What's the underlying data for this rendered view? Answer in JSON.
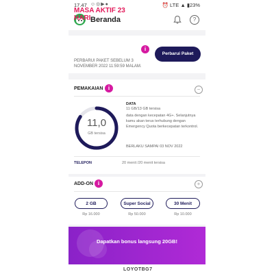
{
  "status_bar": {
    "time": "17.47",
    "network": "LTE",
    "battery": "23%"
  },
  "app_bar": {
    "title": "Beranda",
    "icons": [
      "logo-icon",
      "bell-icon",
      "help-icon"
    ]
  },
  "package": {
    "title": "MASA AKTIF 23 HARI",
    "info_icon": "i",
    "renew_button": "Perbarui Paket",
    "renew_note": "PERBARUI PAKET SEBELUM 3 NOVEMBER 2022 11:59:59 MALAM."
  },
  "usage": {
    "section_title": "PEMAKAIAN",
    "ring_value": "11,0",
    "ring_unit": "GB tersisa",
    "remaining_fraction": 0.846,
    "data_title": "DATA",
    "data_used": "11 GB/13 GB tersisa",
    "data_desc": "data dengan kecepatan 4G+. Selanjutnya kamu akan terus terhubung dengan Emergency Quota berkecepatan terkontrol.",
    "data_valid": "BERLAKU SAMPAI 03 NOV 2022",
    "phone_label": "TELEPON",
    "phone_value": "20 menit /20 menit  tersisa"
  },
  "addons": {
    "section_title": "ADD-ON",
    "items": [
      {
        "label": "2 GB",
        "price": "Rp 16.000"
      },
      {
        "label": "Super Social",
        "price": "Rp 50.000"
      },
      {
        "label": "30 Menit",
        "price": "Rp 10.000"
      }
    ]
  },
  "banner": {
    "text": "Dapatkan bonus langsung 20GB!"
  },
  "bottom": {
    "code": "LOYOTBG7"
  },
  "colors": {
    "accent_red": "#e21a5a",
    "navy": "#1e1a5a",
    "magenta": "#d61aa1",
    "banner_purple": "#9a26cf"
  }
}
